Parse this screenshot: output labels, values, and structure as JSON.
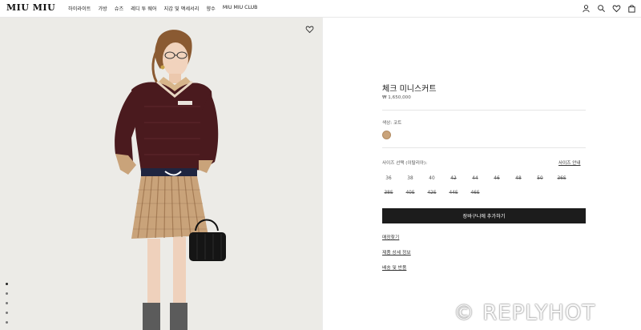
{
  "header": {
    "logo": "MIU MIU",
    "nav": [
      "하이라이트",
      "가방",
      "슈즈",
      "레디 투 웨어",
      "지갑 및 액세서리",
      "향수",
      "MIU MIU CLUB"
    ],
    "icons": [
      "user-icon",
      "search-icon",
      "heart-icon",
      "bag-icon"
    ]
  },
  "product": {
    "title": "체크 미니스커트",
    "price": "₩ 1,650,000",
    "color_label": "색상: 코트",
    "swatch_color": "#c9a37a",
    "size_label": "사이즈 선택 (이탈리아):",
    "size_guide": "사이즈 안내",
    "sizes": [
      {
        "label": "36",
        "available": true
      },
      {
        "label": "38",
        "available": true
      },
      {
        "label": "40",
        "available": true
      },
      {
        "label": "42",
        "available": false
      },
      {
        "label": "44",
        "available": false
      },
      {
        "label": "46",
        "available": false
      },
      {
        "label": "48",
        "available": false
      },
      {
        "label": "50",
        "available": false
      },
      {
        "label": "36S",
        "available": false
      },
      {
        "label": "38S",
        "available": false
      },
      {
        "label": "40S",
        "available": false
      },
      {
        "label": "42S",
        "available": false
      },
      {
        "label": "44S",
        "available": false
      },
      {
        "label": "46S",
        "available": false
      }
    ],
    "add_to_cart": "장바구니에 추가하기",
    "links": [
      "매장찾기",
      "제품 상세 정보",
      "배송 및 반품"
    ]
  },
  "gallery": {
    "image_count": 5,
    "active_index": 0
  },
  "watermark": "© REPLYHOT"
}
